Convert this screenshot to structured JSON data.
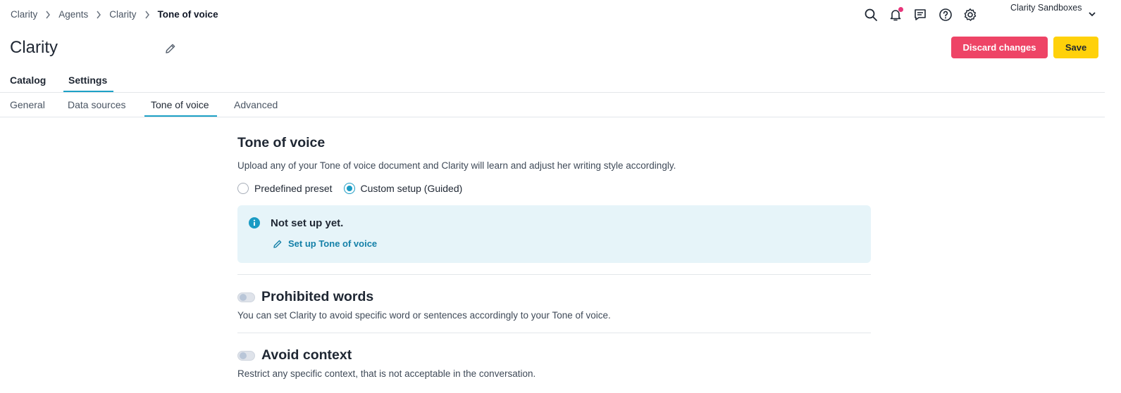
{
  "breadcrumb": {
    "items": [
      "Clarity",
      "Agents",
      "Clarity"
    ],
    "current": "Tone of voice"
  },
  "header": {
    "org_name": "Clarity Sandboxes",
    "icons": [
      "search-icon",
      "bell-icon",
      "chat-icon",
      "help-icon",
      "gear-icon",
      "chevron-down-icon"
    ],
    "notification_dot_color": "#e8357a"
  },
  "page": {
    "title": "Clarity",
    "discard_label": "Discard changes",
    "save_label": "Save"
  },
  "tabs": {
    "primary": [
      "Catalog",
      "Settings"
    ],
    "primary_active": "Settings",
    "secondary": [
      "General",
      "Data sources",
      "Tone of voice",
      "Advanced"
    ],
    "secondary_active": "Tone of voice"
  },
  "tone": {
    "title": "Tone of voice",
    "description": "Upload any of your Tone of voice document and Clarity will learn and adjust her writing style accordingly.",
    "options": [
      "Predefined preset",
      "Custom setup (Guided)"
    ],
    "selected": "Custom setup (Guided)",
    "info_title": "Not set up yet.",
    "info_link": "Set up Tone of voice"
  },
  "prohibited": {
    "enabled": false,
    "title": "Prohibited words",
    "description": "You can set Clarity to avoid specific word or sentences accordingly to your Tone of voice."
  },
  "avoid": {
    "enabled": false,
    "title": "Avoid context",
    "description": "Restrict any specific context, that is not acceptable in the conversation."
  },
  "colors": {
    "accent": "#1da1c6",
    "discard": "#ee4466",
    "save": "#ffd10a",
    "info_bg": "#e6f4f9"
  }
}
